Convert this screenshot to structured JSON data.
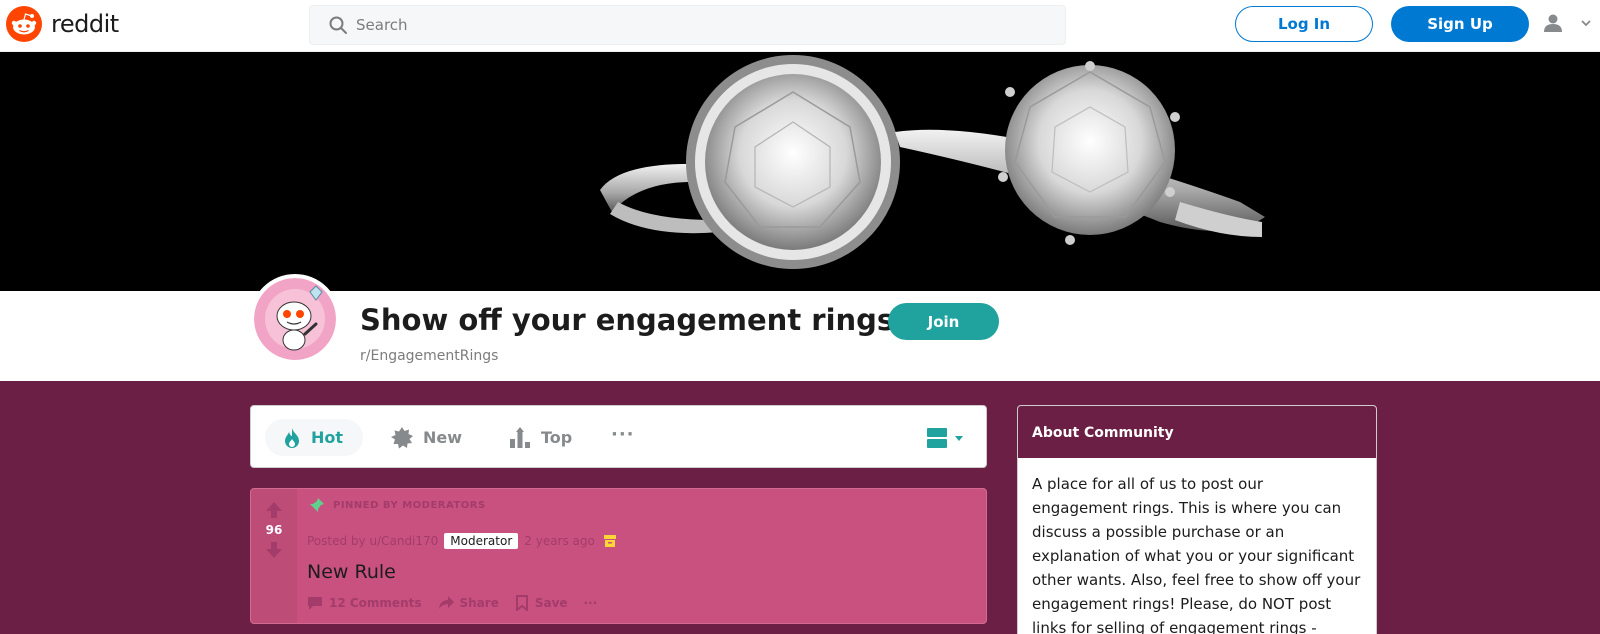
{
  "header": {
    "logo_text": "reddit",
    "search_placeholder": "Search",
    "login_label": "Log In",
    "signup_label": "Sign Up"
  },
  "subreddit": {
    "title": "Show off your engagement rings!",
    "name": "r/EngagementRings",
    "join_label": "Join"
  },
  "sort": {
    "items": [
      {
        "label": "Hot",
        "icon": "flame-icon",
        "active": true
      },
      {
        "label": "New",
        "icon": "burst-icon",
        "active": false
      },
      {
        "label": "Top",
        "icon": "bar-chart-icon",
        "active": false
      }
    ],
    "more": "···"
  },
  "post": {
    "votes": "96",
    "pinned_label": "PINNED BY MODERATORS",
    "posted_by": "Posted by u/Candi170",
    "badge": "Moderator",
    "time": "2 years ago",
    "title": "New Rule",
    "comments_label": "12 Comments",
    "share_label": "Share",
    "save_label": "Save",
    "more": "···"
  },
  "about": {
    "heading": "About Community",
    "body": "A place for all of us to post our engagement rings. This is where you can discuss a possible purchase or an explanation of what you or your significant other wants. Also, feel free to show off your engagement rings! Please, do NOT post links for selling of engagement rings -"
  },
  "colors": {
    "brand_orange": "#ff4500",
    "link_blue": "#0079d3",
    "teal_accent": "#20a39e",
    "page_bg": "#6b1f45",
    "post_bg": "#c9517f"
  }
}
